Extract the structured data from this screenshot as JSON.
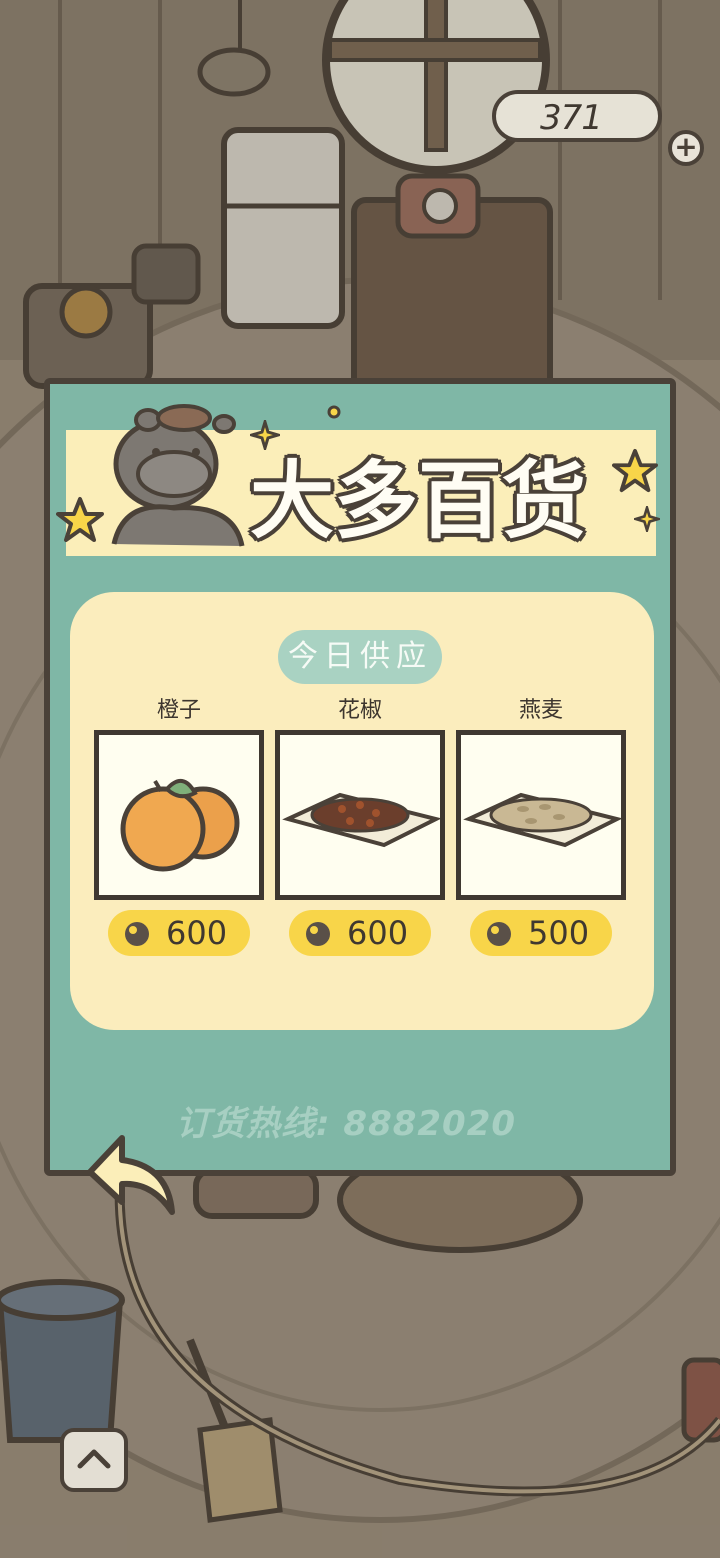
{
  "currency": {
    "clover_count": "371",
    "add_icon": "plus-icon"
  },
  "shop": {
    "title": "大多百货",
    "supply_label": "今日供应",
    "items": [
      {
        "name": "橙子",
        "price": "600",
        "icon": "orange-icon"
      },
      {
        "name": "花椒",
        "price": "600",
        "icon": "pepper-plate-icon"
      },
      {
        "name": "燕麦",
        "price": "500",
        "icon": "oats-plate-icon"
      }
    ],
    "hotline": "订货热线: 8882020"
  },
  "colors": {
    "panel": "#7fb7a6",
    "banner": "#fbeeb9",
    "price_pill": "#f8d549",
    "outline": "#4a4138"
  }
}
